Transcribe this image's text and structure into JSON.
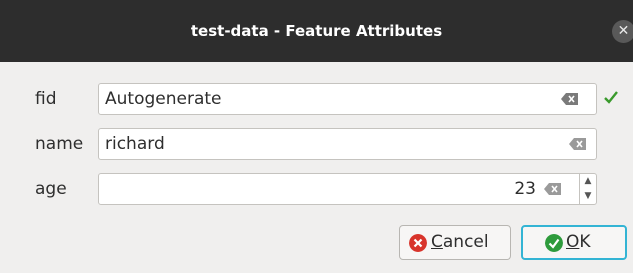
{
  "window": {
    "title": "test-data - Feature Attributes"
  },
  "fields": [
    {
      "label": "fid",
      "value": "Autogenerate"
    },
    {
      "label": "name",
      "value": "richard"
    },
    {
      "label": "age",
      "value": "23"
    }
  ],
  "buttons": {
    "cancel": {
      "mnemonic": "C",
      "rest": "ancel"
    },
    "ok": {
      "mnemonic": "O",
      "rest": "K"
    }
  },
  "colors": {
    "titlebar": "#2d2d2d",
    "valid_check": "#3a9a2c",
    "cancel_icon": "#d8342b",
    "ok_icon": "#2e9b3c",
    "focus_border": "#33b4d4"
  },
  "icons": {
    "close": "close-icon",
    "clear": "clear-field-icon",
    "valid": "checkmark-icon",
    "cancel": "cancel-x-icon",
    "ok": "ok-check-icon"
  }
}
